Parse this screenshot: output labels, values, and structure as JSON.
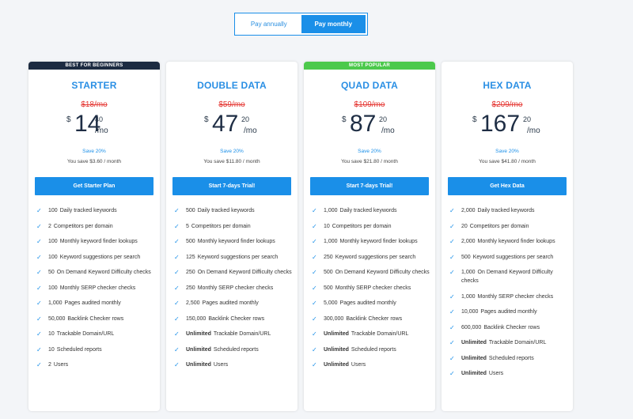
{
  "billing_toggle": {
    "annually": "Pay annually",
    "monthly": "Pay monthly",
    "selected": "monthly"
  },
  "accent_color": "#1a8fe8",
  "plans": [
    {
      "ribbon": "BEST FOR BEGINNERS",
      "ribbon_style": "dark",
      "name": "STARTER",
      "old_price": "$18/mo",
      "currency": "$",
      "price_int": "14",
      "price_dec": "40",
      "per": "/mo",
      "save_pct": "Save 20%",
      "you_save": "You save $3.60 / month",
      "cta": "Get Starter Plan",
      "features": [
        {
          "num": "100",
          "text": "Daily tracked keywords"
        },
        {
          "num": "2",
          "text": "Competitors per domain"
        },
        {
          "num": "100",
          "text": "Monthly keyword finder lookups"
        },
        {
          "num": "100",
          "text": "Keyword suggestions per search"
        },
        {
          "num": "50",
          "text": "On Demand Keyword Difficulty checks"
        },
        {
          "num": "100",
          "text": "Monthly SERP checker checks"
        },
        {
          "num": "1,000",
          "text": "Pages audited monthly"
        },
        {
          "num": "50,000",
          "text": "Backlink Checker rows"
        },
        {
          "num": "10",
          "text": "Trackable Domain/URL"
        },
        {
          "num": "10",
          "text": "Scheduled reports"
        },
        {
          "num": "2",
          "text": "Users"
        }
      ]
    },
    {
      "ribbon": "",
      "ribbon_style": "none",
      "name": "DOUBLE DATA",
      "old_price": "$59/mo",
      "currency": "$",
      "price_int": "47",
      "price_dec": "20",
      "per": "/mo",
      "save_pct": "Save 20%",
      "you_save": "You save $11.80 / month",
      "cta": "Start 7-days Trial!",
      "features": [
        {
          "num": "500",
          "text": "Daily tracked keywords"
        },
        {
          "num": "5",
          "text": "Competitors per domain"
        },
        {
          "num": "500",
          "text": "Monthly keyword finder lookups"
        },
        {
          "num": "125",
          "text": "Keyword suggestions per search"
        },
        {
          "num": "250",
          "text": "On Demand Keyword Difficulty checks"
        },
        {
          "num": "250",
          "text": "Monthly SERP checker checks"
        },
        {
          "num": "2,500",
          "text": "Pages audited monthly"
        },
        {
          "num": "150,000",
          "text": "Backlink Checker rows"
        },
        {
          "num": "Unlimited",
          "text": "Trackable Domain/URL",
          "bold": true
        },
        {
          "num": "Unlimited",
          "text": "Scheduled reports",
          "bold": true
        },
        {
          "num": "Unlimited",
          "text": "Users",
          "bold": true
        }
      ]
    },
    {
      "ribbon": "MOST POPULAR",
      "ribbon_style": "green",
      "name": "QUAD DATA",
      "old_price": "$109/mo",
      "currency": "$",
      "price_int": "87",
      "price_dec": "20",
      "per": "/mo",
      "save_pct": "Save 20%",
      "you_save": "You save $21.80 / month",
      "cta": "Start 7-days Trial!",
      "features": [
        {
          "num": "1,000",
          "text": "Daily tracked keywords"
        },
        {
          "num": "10",
          "text": "Competitors per domain"
        },
        {
          "num": "1,000",
          "text": "Monthly keyword finder lookups"
        },
        {
          "num": "250",
          "text": "Keyword suggestions per search"
        },
        {
          "num": "500",
          "text": "On Demand Keyword Difficulty checks"
        },
        {
          "num": "500",
          "text": "Monthly SERP checker checks"
        },
        {
          "num": "5,000",
          "text": "Pages audited monthly"
        },
        {
          "num": "300,000",
          "text": "Backlink Checker rows"
        },
        {
          "num": "Unlimited",
          "text": "Trackable Domain/URL",
          "bold": true
        },
        {
          "num": "Unlimited",
          "text": "Scheduled reports",
          "bold": true
        },
        {
          "num": "Unlimited",
          "text": "Users",
          "bold": true
        }
      ]
    },
    {
      "ribbon": "",
      "ribbon_style": "none",
      "name": "HEX DATA",
      "old_price": "$209/mo",
      "currency": "$",
      "price_int": "167",
      "price_dec": "20",
      "per": "/mo",
      "save_pct": "Save 20%",
      "you_save": "You save $41.80 / month",
      "cta": "Get Hex Data",
      "features": [
        {
          "num": "2,000",
          "text": "Daily tracked keywords"
        },
        {
          "num": "20",
          "text": "Competitors per domain"
        },
        {
          "num": "2,000",
          "text": "Monthly keyword finder lookups"
        },
        {
          "num": "500",
          "text": "Keyword suggestions per search"
        },
        {
          "num": "1,000",
          "text": "On Demand Keyword Difficulty checks"
        },
        {
          "num": "1,000",
          "text": "Monthly SERP checker checks"
        },
        {
          "num": "10,000",
          "text": "Pages audited monthly"
        },
        {
          "num": "600,000",
          "text": "Backlink Checker rows"
        },
        {
          "num": "Unlimited",
          "text": "Trackable Domain/URL",
          "bold": true
        },
        {
          "num": "Unlimited",
          "text": "Scheduled reports",
          "bold": true
        },
        {
          "num": "Unlimited",
          "text": "Users",
          "bold": true
        }
      ]
    }
  ]
}
